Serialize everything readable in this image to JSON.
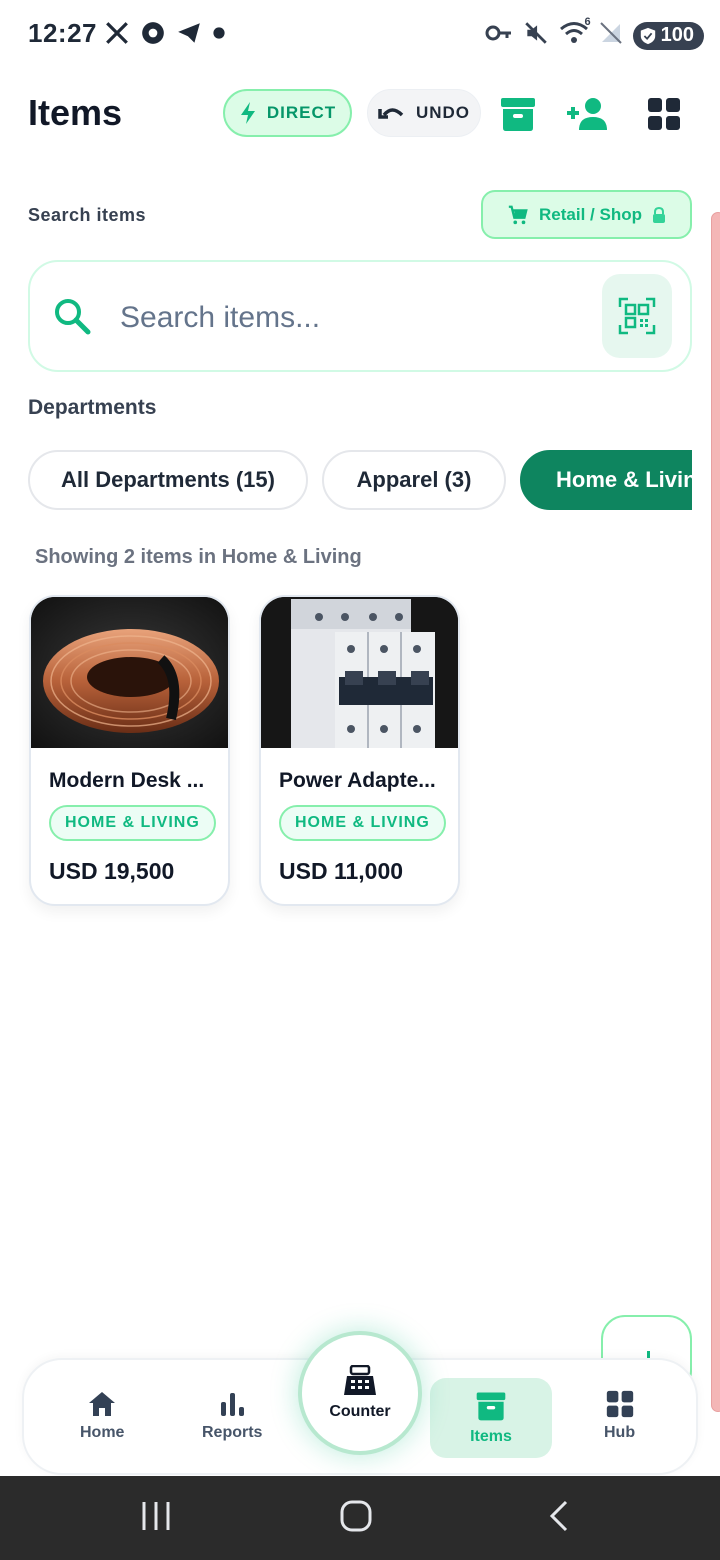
{
  "status_bar": {
    "time": "12:27",
    "icons_left": [
      "x-logo-icon",
      "chrome-like-icon",
      "telegram-icon",
      "dot-icon"
    ],
    "icons_right": [
      "key-icon",
      "mute-icon",
      "wifi-icon",
      "no-signal-icon"
    ],
    "wifi_badge": "6",
    "battery": "100"
  },
  "header": {
    "title": "Items",
    "direct_label": "DIRECT",
    "undo_label": "UNDO",
    "icons": [
      "archive-icon",
      "add-user-icon",
      "grid-icon"
    ]
  },
  "search": {
    "label": "Search items",
    "mode_chip": "Retail / Shop",
    "placeholder": "Search items...",
    "value": ""
  },
  "departments": {
    "label": "Departments",
    "chips": [
      {
        "label": "All Departments (15)",
        "active": false
      },
      {
        "label": "Apparel (3)",
        "active": false
      },
      {
        "label": "Home & Living",
        "active": true
      }
    ]
  },
  "results": {
    "summary": "Showing 2 items in Home & Living",
    "items": [
      {
        "name": "Modern Desk ...",
        "tag": "HOME & LIVING",
        "price": "USD 19,500",
        "image": "copper-wire-coil"
      },
      {
        "name": "Power Adapte...",
        "tag": "HOME & LIVING",
        "price": "USD 11,000",
        "image": "circuit-breaker"
      }
    ]
  },
  "bottom_nav": {
    "items": [
      {
        "label": "Home",
        "icon": "home-icon"
      },
      {
        "label": "Reports",
        "icon": "bar-chart-icon"
      },
      {
        "label": "Counter",
        "icon": "cash-register-icon"
      },
      {
        "label": "Items",
        "icon": "archive-icon",
        "active": true
      },
      {
        "label": "Hub",
        "icon": "grid-icon"
      }
    ]
  },
  "colors": {
    "accent": "#10b981",
    "accent_dark": "#0e855f",
    "accent_light": "#dcfce7"
  }
}
